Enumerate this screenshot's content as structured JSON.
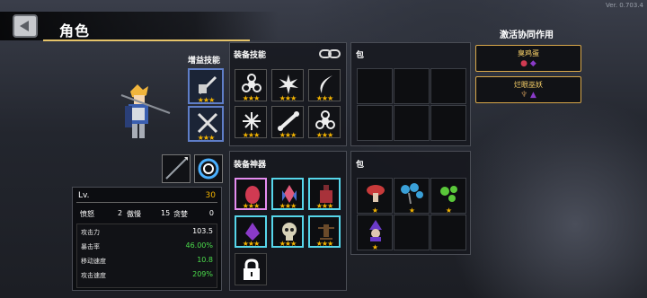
{
  "version": "Ver. 0.703.4",
  "header": {
    "title": "角色"
  },
  "sections": {
    "growth_skill": "增益技能",
    "equip_skill": "装备技能",
    "bag": "包",
    "equip_artifact": "装备神器",
    "bag2": "包",
    "synergy_title": "激活协同作用"
  },
  "synergies": [
    {
      "name": "臭鸡蛋"
    },
    {
      "name": "烂眼巫妖"
    }
  ],
  "stats": {
    "level_label": "Lv.",
    "level_value": "30",
    "attrs": [
      {
        "label": "愤怒",
        "value": "2"
      },
      {
        "label": "傲慢",
        "value": "15"
      },
      {
        "label": "贪婪",
        "value": "0"
      }
    ],
    "rows": [
      {
        "label": "攻击力",
        "value": "103.5"
      },
      {
        "label": "暴击率",
        "value": "46.00%"
      },
      {
        "label": "移动速度",
        "value": "10.8"
      },
      {
        "label": "攻击速度",
        "value": "209%"
      }
    ]
  },
  "stars": {
    "s3": "★★★",
    "s1": "★"
  }
}
